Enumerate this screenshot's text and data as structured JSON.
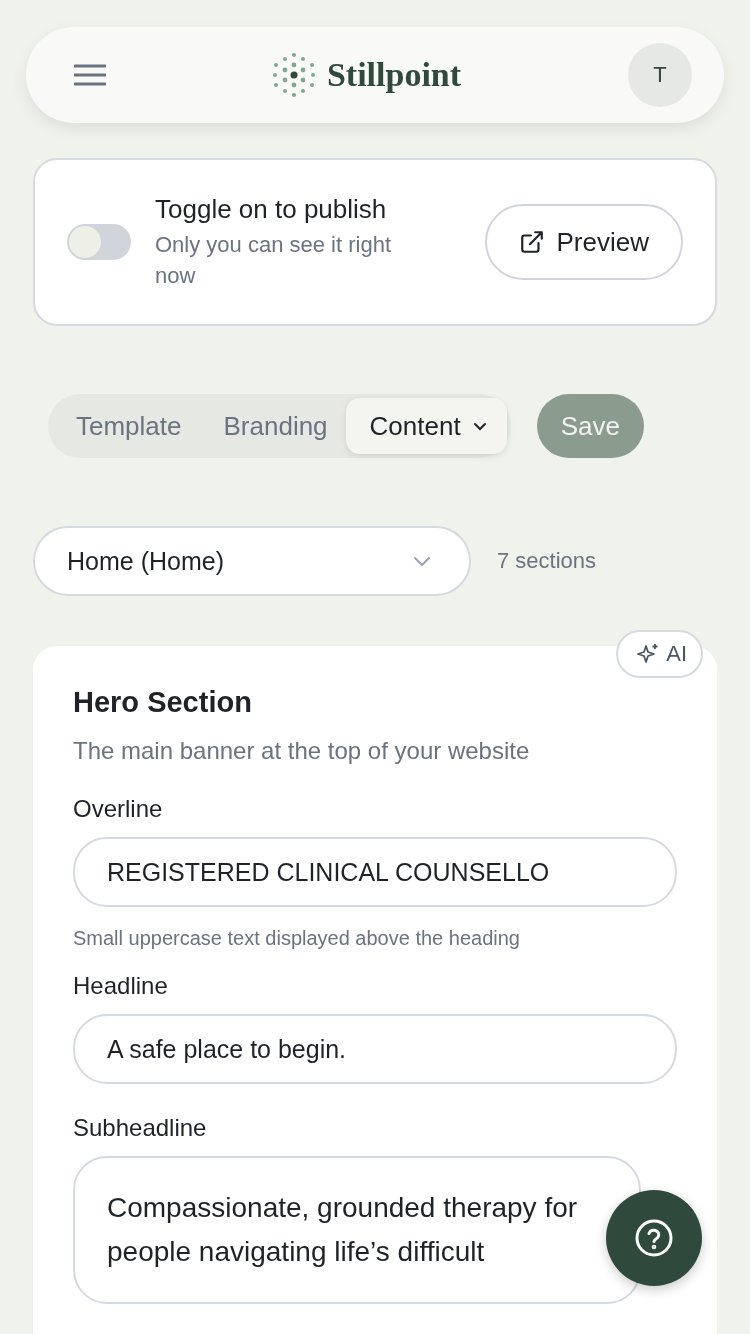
{
  "header": {
    "logo_text": "Stillpoint",
    "avatar_initial": "T"
  },
  "publish": {
    "on": false,
    "title": "Toggle on to publish",
    "subtitle": "Only you can see it right now",
    "preview_label": "Preview"
  },
  "tabs": [
    {
      "label": "Template",
      "selected": false,
      "has_menu": false
    },
    {
      "label": "Branding",
      "selected": false,
      "has_menu": false
    },
    {
      "label": "Content",
      "selected": true,
      "has_menu": true
    }
  ],
  "save_button": {
    "label": "Save",
    "disabled": true
  },
  "page_select": {
    "value": "Home (Home)",
    "count": "7 sections"
  },
  "section": {
    "ai_label": "AI",
    "title": "Hero Section",
    "description": "The main banner at the top of your website",
    "fields": [
      {
        "kind": "input",
        "label": "Overline",
        "value": "REGISTERED CLINICAL COUNSELLO",
        "hint": "Small uppercase text displayed above the heading"
      },
      {
        "kind": "input",
        "label": "Headline",
        "value": "A safe place to begin."
      },
      {
        "kind": "textarea",
        "label": "Subheadline",
        "value": "Compassionate, grounded therapy for people navigating life’s difficult"
      }
    ]
  }
}
